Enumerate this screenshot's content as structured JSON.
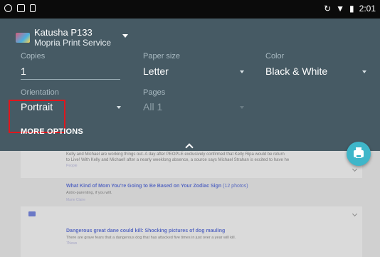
{
  "status_bar": {
    "time": "2:01"
  },
  "printer": {
    "name": "Katusha P133",
    "service": "Mopria Print Service"
  },
  "options": {
    "copies_label": "Copies",
    "copies_value": "1",
    "paper_size_label": "Paper size",
    "paper_size_value": "Letter",
    "color_label": "Color",
    "color_value": "Black & White",
    "orientation_label": "Orientation",
    "orientation_value": "Portrait",
    "pages_label": "Pages",
    "pages_value": "All 1"
  },
  "more_options": "MORE OPTIONS",
  "feed": {
    "item1_line1": "Kelly and Michael are working things out. A day after PEOPLE exclusively confirmed that Kelly Ripa would be return",
    "item1_line2": "to Live! With Kelly and Michael! after a nearly weeklong absence, a source says Michael Strahan is excited to have he",
    "item1_source": "People",
    "item2_title": "What Kind of Mom You're Going to Be Based on Your Zodiac Sign",
    "item2_count": "(12 photos)",
    "item2_sub": "Astro-parenting, if you will.",
    "item2_source": "Marie Claire",
    "item3_title": "Dangerous great dane could kill: Shocking pictures of dog mauling",
    "item3_sub": "There are grave fears that a dangerous dog that has attacked five times in just over a year will kill.",
    "item3_source": "7News"
  },
  "colors": {
    "panel": "#465a64",
    "highlight": "#e0161c",
    "fab": "#3fb6c9"
  },
  "icons": [
    "notification-icon",
    "image-icon",
    "sim-icon",
    "sync-icon",
    "wifi-icon",
    "battery-icon",
    "print-icon",
    "chevron-up-icon"
  ]
}
